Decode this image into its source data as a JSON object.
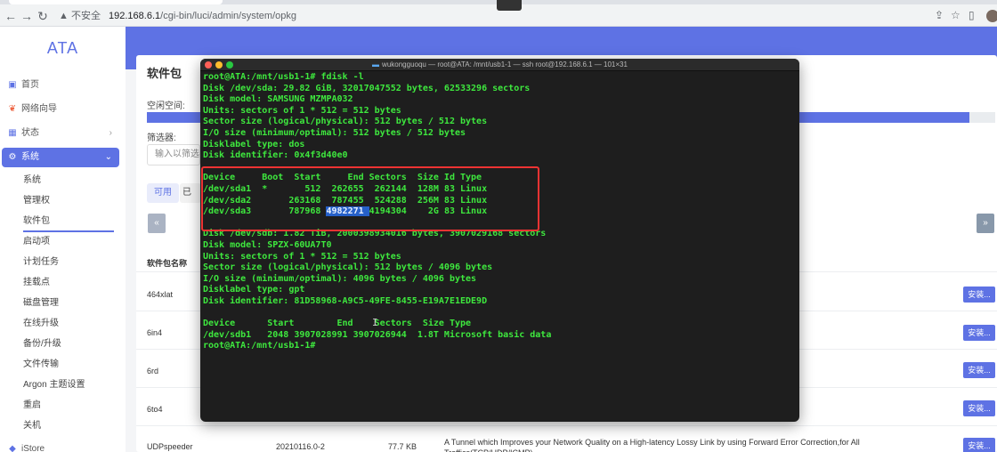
{
  "browser": {
    "insecure_label": "不安全",
    "url_host": "192.168.6.1",
    "url_path": "/cgi-bin/luci/admin/system/opkg"
  },
  "sidebar": {
    "logo": "ATA",
    "items": [
      {
        "label": "首页",
        "icon": "dashboard-icon"
      },
      {
        "label": "网络向导",
        "icon": "wizard-icon"
      },
      {
        "label": "状态",
        "icon": "grid-icon"
      },
      {
        "label": "系统",
        "icon": "gear-icon"
      }
    ],
    "subitems": [
      "系统",
      "管理权",
      "软件包",
      "启动项",
      "计划任务",
      "挂载点",
      "磁盘管理",
      "在线升级",
      "备份/升级",
      "文件传输",
      "Argon 主题设置",
      "重启",
      "关机"
    ],
    "bottom_item": "iStore"
  },
  "main": {
    "title": "软件包",
    "free_space_label": "空闲空间:",
    "free_space_fill": 0.97,
    "filter_label": "筛选器:",
    "filter_placeholder": "输入以筛选...",
    "tabs": [
      "可用",
      "已安装"
    ],
    "pager_prev": "«",
    "pager_next": "»",
    "col_name": "软件包名称",
    "packages": [
      "464xlat",
      "6in4",
      "6rd",
      "6to4",
      "UDPspeeder"
    ],
    "install_label": "安装...",
    "last_row": {
      "version": "20210116.0-2",
      "size": "77.7 KB",
      "desc": "A Tunnel which Improves your Network Quality on a High-latency Lossy Link by using Forward Error Correction,for All Traffics(TCP/UDP/ICMP)"
    }
  },
  "terminal": {
    "title": "wukongguoqu — root@ATA: /mnt/usb1-1 — ssh root@192.168.6.1 — 101×31",
    "lines": [
      "root@ATA:/mnt/usb1-1# fdisk -l",
      "Disk /dev/sda: 29.82 GiB, 32017047552 bytes, 62533296 sectors",
      "Disk model: SAMSUNG MZMPA032",
      "Units: sectors of 1 * 512 = 512 bytes",
      "Sector size (logical/physical): 512 bytes / 512 bytes",
      "I/O size (minimum/optimal): 512 bytes / 512 bytes",
      "Disklabel type: dos",
      "Disk identifier: 0x4f3d40e0",
      "",
      "Device     Boot  Start     End Sectors  Size Id Type",
      "/dev/sda1  *       512  262655  262144  128M 83 Linux",
      "/dev/sda2       263168  787455  524288  256M 83 Linux",
      "",
      "",
      "Disk /dev/sdb: 1.82 TiB, 2000398934016 bytes, 3907029168 sectors",
      "Disk model: SPZX-60UA7T0",
      "Units: sectors of 1 * 512 = 512 bytes",
      "Sector size (logical/physical): 512 bytes / 4096 bytes",
      "I/O size (minimum/optimal): 4096 bytes / 4096 bytes",
      "Disklabel type: gpt",
      "Disk identifier: 81D58968-A9C5-49FE-8455-E19A7E1EDE9D",
      "",
      "Device      Start        End    Sectors  Size Type",
      "/dev/sdb1   2048 3907028991 3907026944  1.8T Microsoft basic data",
      "root@ATA:/mnt/usb1-1#"
    ],
    "sda3_prefix": "/dev/sda3       787968 ",
    "sda3_selected": "4982271 ",
    "sda3_suffix": "4194304    2G 83 Linux"
  }
}
